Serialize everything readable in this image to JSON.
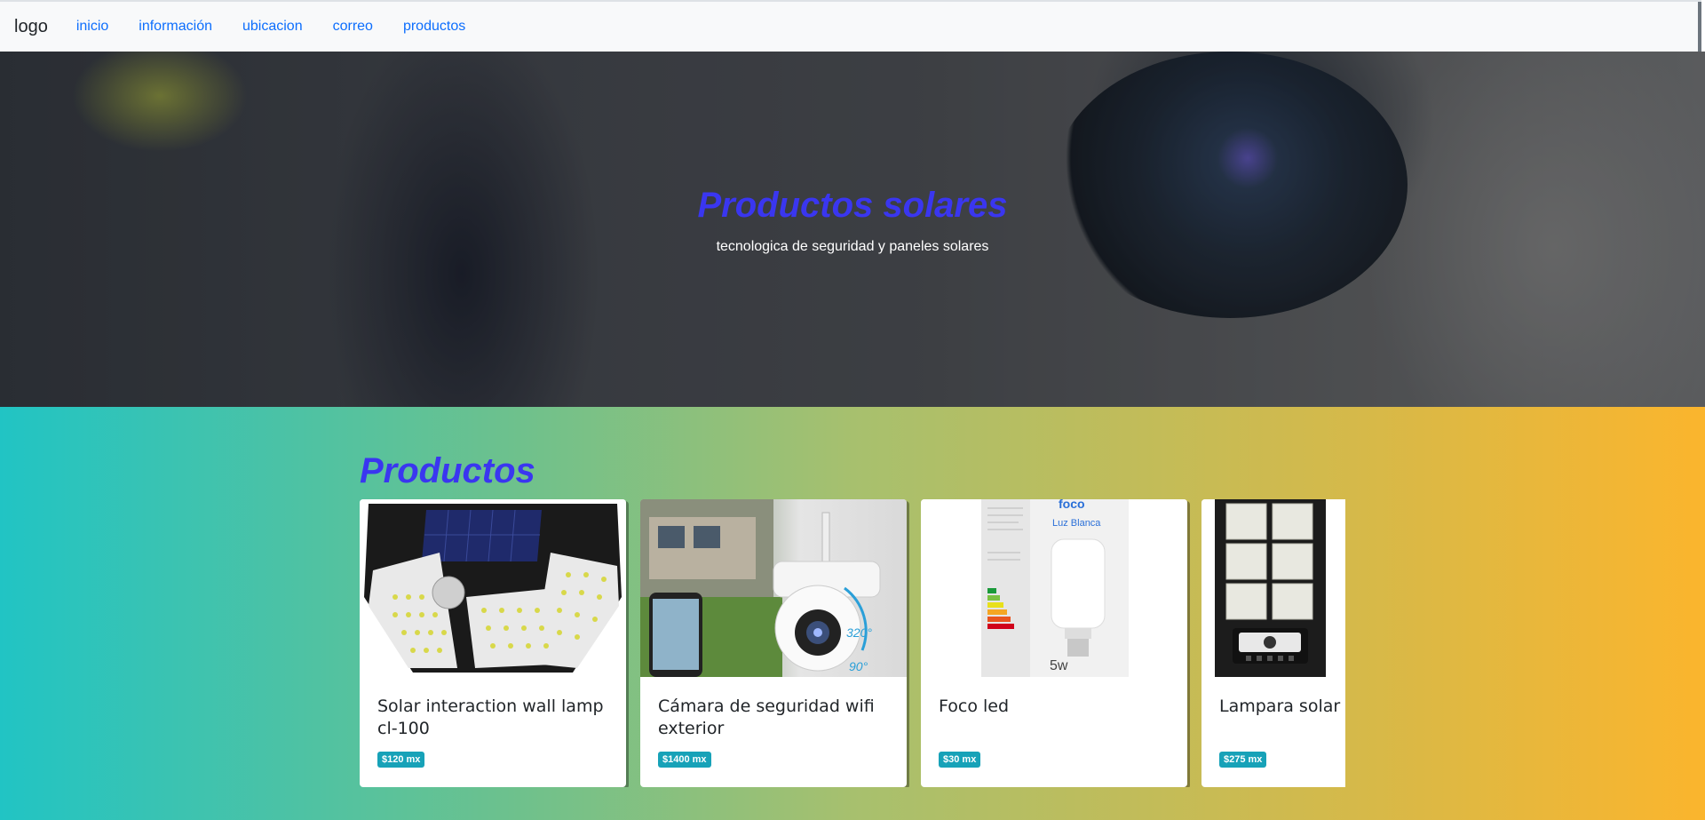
{
  "navbar": {
    "brand": "logo",
    "links": [
      "inicio",
      "información",
      "ubicacion",
      "correo",
      "productos"
    ]
  },
  "hero": {
    "title": "Productos solares",
    "subtitle": "tecnologica de seguridad y paneles solares"
  },
  "products": {
    "title": "Productos",
    "items": [
      {
        "name": "Solar interaction wall lamp cl-100",
        "price": "$120 mx",
        "image_text": ""
      },
      {
        "name": "Cámara de seguridad wifi exterior",
        "price": "$1400 mx",
        "image_text": "320°|90°"
      },
      {
        "name": "Foco led",
        "price": "$30 mx",
        "image_text": "Luz Blanca|5w"
      },
      {
        "name": "Lampara solar",
        "price": "$275 mx",
        "image_text": ""
      }
    ]
  },
  "image_labels": {
    "camera_angle_h": "320°",
    "camera_angle_v": "90°",
    "bulb_brand": "foco",
    "bulb_color": "Luz Blanca",
    "bulb_watts": "5w"
  },
  "colors": {
    "accent_title": "#3a36f0",
    "link": "#0d6efd",
    "badge": "#17a2b8",
    "gradient_start": "#21c4c4",
    "gradient_end": "#fbb52d"
  }
}
